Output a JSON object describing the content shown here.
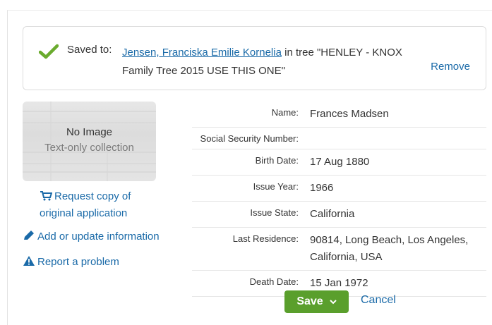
{
  "saved": {
    "label": "Saved to:",
    "person_link": "Jensen, Franciska Emilie Kornelia",
    "tree_text_1": " in tree \"HENLEY - KNOX",
    "tree_text_2": "Family Tree 2015 USE THIS ONE\"",
    "remove": "Remove"
  },
  "thumbnail": {
    "title": "No Image",
    "subtitle": "Text-only collection"
  },
  "sidebar": {
    "request_copy": "Request copy of original application",
    "add_update": "Add or update information",
    "report_problem": "Report a problem"
  },
  "details": [
    {
      "label": "Name:",
      "value": "Frances Madsen"
    },
    {
      "label": "Social Security Number:",
      "value": ""
    },
    {
      "label": "Birth Date:",
      "value": "17 Aug 1880"
    },
    {
      "label": "Issue Year:",
      "value": "1966"
    },
    {
      "label": "Issue State:",
      "value": "California"
    },
    {
      "label": "Last Residence:",
      "value": "90814, Long Beach, Los Angeles, California, USA"
    },
    {
      "label": "Death Date:",
      "value": "15 Jan 1972"
    }
  ],
  "actions": {
    "save": "Save",
    "cancel": "Cancel"
  },
  "colors": {
    "link": "#1a6aa8",
    "save_green": "#5a9f2c",
    "check_green": "#6aab2e"
  }
}
